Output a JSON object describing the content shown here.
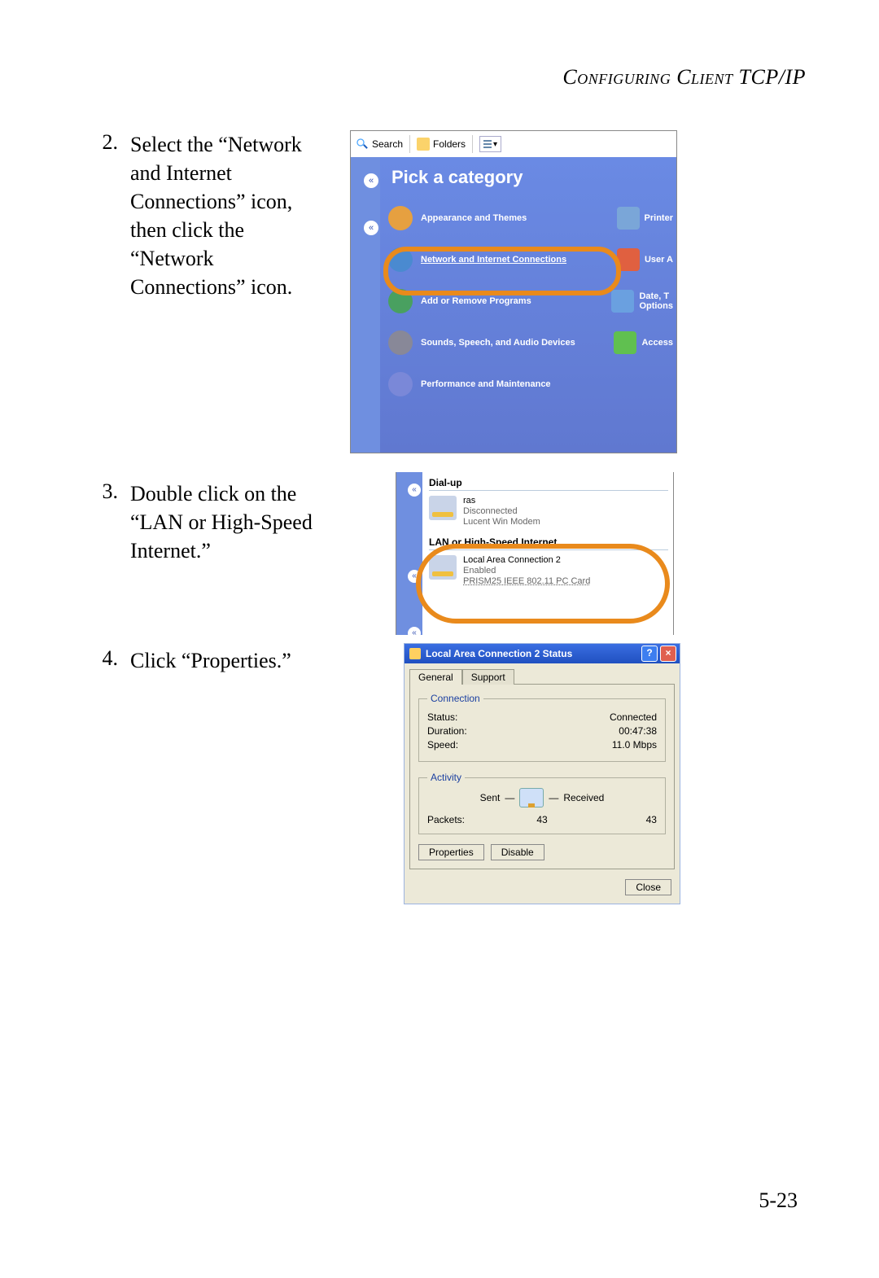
{
  "header": "Configuring Client TCP/IP",
  "steps": {
    "s2": {
      "num": "2.",
      "text": "Select the “Network and Internet Connections” icon, then click the “Network Connections” icon."
    },
    "s3": {
      "num": "3.",
      "text": "Double click on the “LAN or High-Speed Internet.”"
    },
    "s4": {
      "num": "4.",
      "text": "Click “Properties.”"
    }
  },
  "page_number": "5-23",
  "shot1": {
    "toolbar": {
      "search": "Search",
      "folders": "Folders",
      "view_glyph": "▾"
    },
    "title": "Pick a category",
    "cats": [
      {
        "label": "Appearance and Themes",
        "right": "Printer",
        "icon": "#e6a040",
        "ricon": "#7aa6d8"
      },
      {
        "label": "Network and Internet Connections",
        "right": "User A",
        "icon": "#4a8ad0",
        "ricon": "#e06040",
        "under": true
      },
      {
        "label": "Add or Remove Programs",
        "right": "Date, T\nOptions",
        "icon": "#49a060",
        "ricon": "#6aa0e0"
      },
      {
        "label": "Sounds, Speech, and Audio Devices",
        "right": "Access",
        "icon": "#888898",
        "ricon": "#60c050"
      },
      {
        "label": "Performance and Maintenance",
        "right": "",
        "icon": "#7a88d8",
        "ricon": ""
      }
    ]
  },
  "shot2": {
    "group1": "Dial-up",
    "item1": {
      "title": "ras",
      "status": "Disconnected",
      "device": "Lucent Win Modem"
    },
    "group2": "LAN or High-Speed Internet",
    "item2": {
      "title": "Local Area Connection 2",
      "status": "Enabled",
      "device": "PRISM25 IEEE 802.11 PC Card"
    }
  },
  "shot3": {
    "title": "Local Area Connection 2 Status",
    "help": "?",
    "close": "×",
    "tabs": {
      "general": "General",
      "support": "Support"
    },
    "conn": {
      "legend": "Connection",
      "status_l": "Status:",
      "status_v": "Connected",
      "duration_l": "Duration:",
      "duration_v": "00:47:38",
      "speed_l": "Speed:",
      "speed_v": "11.0 Mbps"
    },
    "act": {
      "legend": "Activity",
      "sent": "Sent",
      "dash": "—",
      "received": "Received",
      "packets_l": "Packets:",
      "sent_v": "43",
      "recv_v": "43"
    },
    "btns": {
      "properties": "Properties",
      "disable": "Disable",
      "close": "Close"
    }
  }
}
